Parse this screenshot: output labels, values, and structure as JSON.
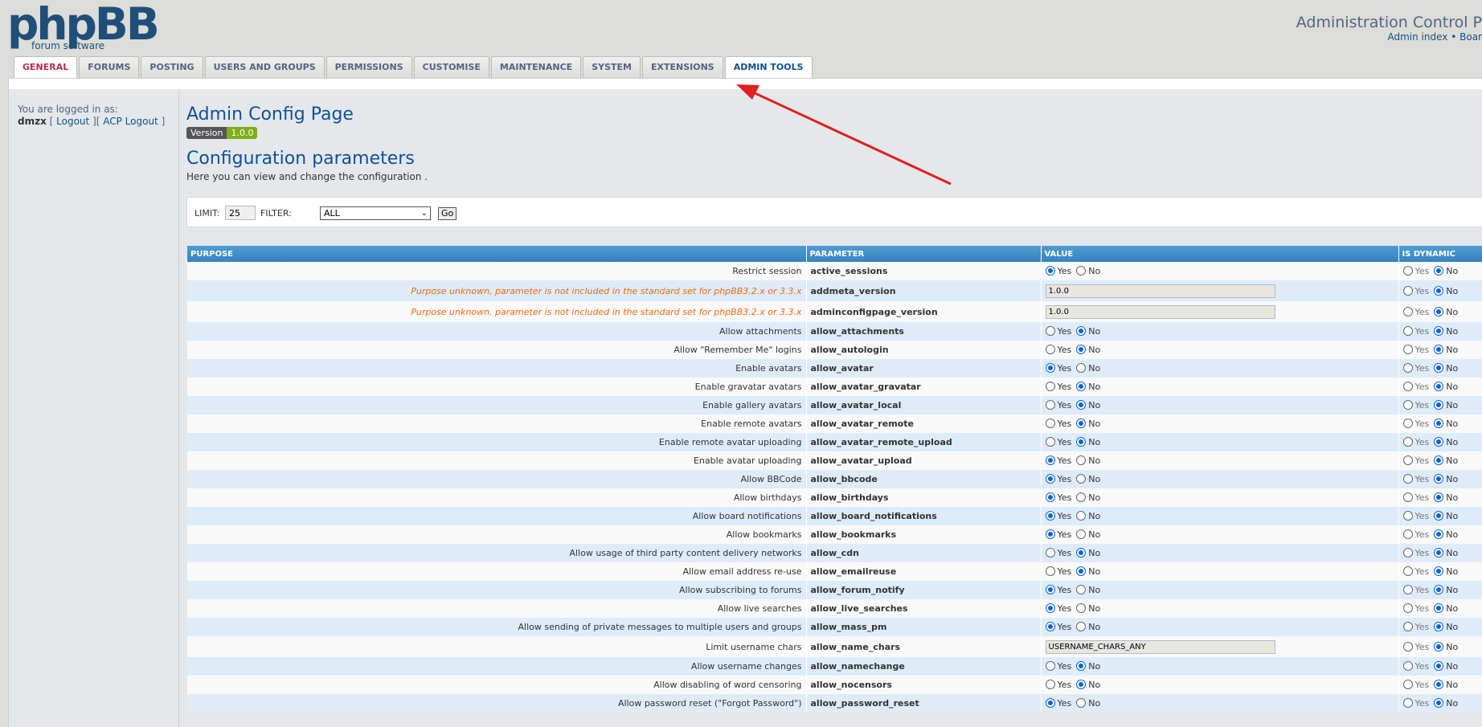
{
  "brand": {
    "logo": "phpBB",
    "tagline": "forum software"
  },
  "header": {
    "title": "Administration Control P",
    "links": [
      "Admin index",
      "Boar"
    ]
  },
  "tabs": [
    {
      "label": "General",
      "state": "active"
    },
    {
      "label": "Forums"
    },
    {
      "label": "Posting"
    },
    {
      "label": "Users and Groups"
    },
    {
      "label": "Permissions"
    },
    {
      "label": "Customise"
    },
    {
      "label": "Maintenance"
    },
    {
      "label": "System"
    },
    {
      "label": "Extensions"
    },
    {
      "label": "Admin Tools",
      "state": "selected"
    }
  ],
  "sidebar": {
    "logged_in_text": "You are logged in as:",
    "username": "dmzx",
    "logout": "Logout",
    "acp_logout": "ACP Logout"
  },
  "main": {
    "page_title": "Admin Config Page",
    "version_label": "Version",
    "version_value": "1.0.0",
    "section_title": "Configuration parameters",
    "description": "Here you can view and change the configuration ."
  },
  "filter": {
    "limit_label": "LIMIT:",
    "limit_value": "25",
    "filter_label": "FILTER:",
    "filter_value": "ALL",
    "go_label": "Go"
  },
  "table": {
    "columns": [
      "Purpose",
      "Parameter",
      "Value",
      "Is Dynamic"
    ],
    "yes_label": "Yes",
    "no_label": "No",
    "rows": [
      {
        "purpose": "Restrict session",
        "param": "active_sessions",
        "type": "bool",
        "value": "yes",
        "dynamic": "no"
      },
      {
        "purpose": "Purpose unknown, parameter is not included in the standard set for phpBB3.2.x or 3.3.x",
        "unknown": true,
        "param": "addmeta_version",
        "type": "text",
        "value": "1.0.0",
        "dynamic": "no"
      },
      {
        "purpose": "Purpose unknown, parameter is not included in the standard set for phpBB3.2.x or 3.3.x",
        "unknown": true,
        "param": "adminconfigpage_version",
        "type": "text",
        "value": "1.0.0",
        "dynamic": "no"
      },
      {
        "purpose": "Allow attachments",
        "param": "allow_attachments",
        "type": "bool",
        "value": "no",
        "dynamic": "no"
      },
      {
        "purpose": "Allow \"Remember Me\" logins",
        "param": "allow_autologin",
        "type": "bool",
        "value": "no",
        "dynamic": "no"
      },
      {
        "purpose": "Enable avatars",
        "param": "allow_avatar",
        "type": "bool",
        "value": "yes",
        "dynamic": "no"
      },
      {
        "purpose": "Enable gravatar avatars",
        "param": "allow_avatar_gravatar",
        "type": "bool",
        "value": "no",
        "dynamic": "no"
      },
      {
        "purpose": "Enable gallery avatars",
        "param": "allow_avatar_local",
        "type": "bool",
        "value": "no",
        "dynamic": "no"
      },
      {
        "purpose": "Enable remote avatars",
        "param": "allow_avatar_remote",
        "type": "bool",
        "value": "no",
        "dynamic": "no"
      },
      {
        "purpose": "Enable remote avatar uploading",
        "param": "allow_avatar_remote_upload",
        "type": "bool",
        "value": "no",
        "dynamic": "no"
      },
      {
        "purpose": "Enable avatar uploading",
        "param": "allow_avatar_upload",
        "type": "bool",
        "value": "yes",
        "dynamic": "no"
      },
      {
        "purpose": "Allow BBCode",
        "param": "allow_bbcode",
        "type": "bool",
        "value": "yes",
        "dynamic": "no"
      },
      {
        "purpose": "Allow birthdays",
        "param": "allow_birthdays",
        "type": "bool",
        "value": "yes",
        "dynamic": "no"
      },
      {
        "purpose": "Allow board notifications",
        "param": "allow_board_notifications",
        "type": "bool",
        "value": "yes",
        "dynamic": "no"
      },
      {
        "purpose": "Allow bookmarks",
        "param": "allow_bookmarks",
        "type": "bool",
        "value": "yes",
        "dynamic": "no"
      },
      {
        "purpose": "Allow usage of third party content delivery networks",
        "param": "allow_cdn",
        "type": "bool",
        "value": "no",
        "dynamic": "no"
      },
      {
        "purpose": "Allow email address re-use",
        "param": "allow_emailreuse",
        "type": "bool",
        "value": "no",
        "dynamic": "no"
      },
      {
        "purpose": "Allow subscribing to forums",
        "param": "allow_forum_notify",
        "type": "bool",
        "value": "yes",
        "dynamic": "no"
      },
      {
        "purpose": "Allow live searches",
        "param": "allow_live_searches",
        "type": "bool",
        "value": "yes",
        "dynamic": "no"
      },
      {
        "purpose": "Allow sending of private messages to multiple users and groups",
        "param": "allow_mass_pm",
        "type": "bool",
        "value": "yes",
        "dynamic": "no"
      },
      {
        "purpose": "Limit username chars",
        "param": "allow_name_chars",
        "type": "text",
        "value": "USERNAME_CHARS_ANY",
        "dynamic": "no"
      },
      {
        "purpose": "Allow username changes",
        "param": "allow_namechange",
        "type": "bool",
        "value": "no",
        "dynamic": "no"
      },
      {
        "purpose": "Allow disabling of word censoring",
        "param": "allow_nocensors",
        "type": "bool",
        "value": "no",
        "dynamic": "no"
      },
      {
        "purpose": "Allow password reset (\"Forgot Password\")",
        "param": "allow_password_reset",
        "type": "bool",
        "value": "yes",
        "dynamic": "no"
      }
    ]
  },
  "colors": {
    "accent": "#105289",
    "active_tab": "#bc2a4d",
    "header_row": "#3b8bc6",
    "unknown_text": "#f26a0e",
    "annotation_arrow": "#e02020"
  }
}
